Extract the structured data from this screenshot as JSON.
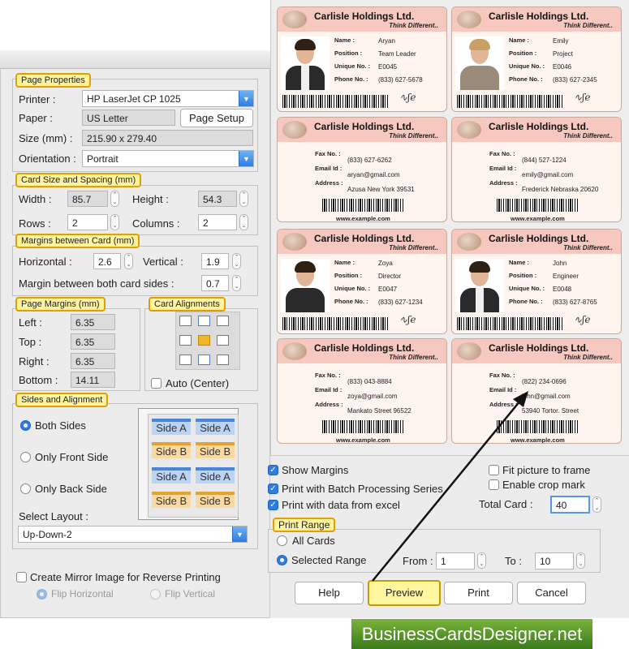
{
  "page_properties": {
    "title": "Page Properties",
    "printer_label": "Printer :",
    "printer_value": "HP LaserJet CP 1025",
    "paper_label": "Paper :",
    "paper_value": "US Letter",
    "page_setup_btn": "Page Setup",
    "size_label": "Size (mm) :",
    "size_value": "215.90 x 279.40",
    "orientation_label": "Orientation :",
    "orientation_value": "Portrait"
  },
  "card_size": {
    "title": "Card Size and Spacing (mm)",
    "width_label": "Width :",
    "width_value": "85.7",
    "height_label": "Height :",
    "height_value": "54.3",
    "rows_label": "Rows :",
    "rows_value": "2",
    "columns_label": "Columns :",
    "columns_value": "2"
  },
  "margins_card": {
    "title": "Margins between Card (mm)",
    "horizontal_label": "Horizontal :",
    "horizontal_value": "2.6",
    "vertical_label": "Vertical :",
    "vertical_value": "1.9",
    "both_label": "Margin between both card sides :",
    "both_value": "0.7"
  },
  "page_margins": {
    "title": "Page Margins (mm)",
    "left_label": "Left :",
    "left_value": "6.35",
    "top_label": "Top :",
    "top_value": "6.35",
    "right_label": "Right :",
    "right_value": "6.35",
    "bottom_label": "Bottom :",
    "bottom_value": "14.11"
  },
  "card_alignments": {
    "title": "Card Alignments",
    "auto_label": "Auto (Center)",
    "selected": "middle-center"
  },
  "sides": {
    "title": "Sides and Alignment",
    "both": "Both Sides",
    "front": "Only Front Side",
    "back": "Only Back Side",
    "selected": "Both Sides",
    "layout_label": "Select Layout :",
    "layout_value": "Up-Down-2",
    "preview_labels": {
      "a": "Side A",
      "b": "Side B"
    }
  },
  "mirror": {
    "label": "Create Mirror Image for Reverse Printing",
    "flip_h": "Flip Horizontal",
    "flip_v": "Flip Vertical"
  },
  "options": {
    "show_margins": "Show Margins",
    "batch": "Print with Batch Processing Series",
    "excel": "Print with data from excel",
    "fit_picture": "Fit picture to frame",
    "crop_mark": "Enable crop mark",
    "total_card_label": "Total Card :",
    "total_card_value": "40"
  },
  "print_range": {
    "title": "Print Range",
    "all": "All Cards",
    "selected": "Selected Range",
    "from_label": "From :",
    "from_value": "1",
    "to_label": "To :",
    "to_value": "10"
  },
  "buttons": {
    "help": "Help",
    "preview": "Preview",
    "print": "Print",
    "cancel": "Cancel"
  },
  "brand": "BusinessCardsDesigner.net",
  "cards": {
    "company": "Carlisle Holdings Ltd.",
    "tagline": "Think Different..",
    "website": "www.example.com",
    "labels": {
      "name": "Name :",
      "position": "Position :",
      "unique": "Unique No. :",
      "phone": "Phone No. :",
      "fax": "Fax No. :",
      "email": "Email Id :",
      "address": "Address :"
    },
    "fronts": [
      {
        "name": "Aryan",
        "position": "Team Leader",
        "unique": "E0045",
        "phone": "(833) 627-5678"
      },
      {
        "name": "Emily",
        "position": "Project",
        "unique": "E0046",
        "phone": "(833) 627-2345"
      },
      {
        "name": "Zoya",
        "position": "Director",
        "unique": "E0047",
        "phone": "(833) 627-1234"
      },
      {
        "name": "John",
        "position": "Engineer",
        "unique": "E0048",
        "phone": "(833) 627-8765"
      }
    ],
    "backs": [
      {
        "fax": "(833) 627-6262",
        "email": "aryan@gmail.com",
        "address": "Azusa New York 39531"
      },
      {
        "fax": "(844) 527-1224",
        "email": "emily@gmail.com",
        "address": "Frederick Nebraska 20620"
      },
      {
        "fax": "(833) 043-8884",
        "email": "zoya@gmail.com",
        "address": "Mankato Street 96522"
      },
      {
        "fax": "(822) 234-0696",
        "email": "john@gmail.com",
        "address": "53940 Tortor. Street"
      }
    ]
  }
}
